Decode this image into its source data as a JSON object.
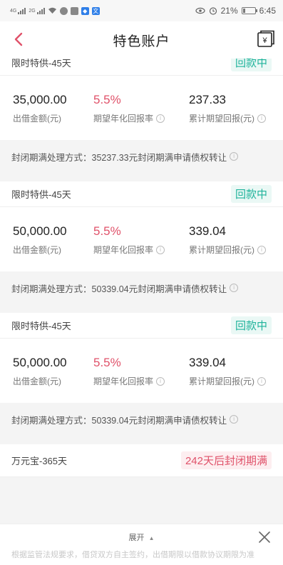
{
  "statusbar": {
    "net1": "4G",
    "net2": "2G",
    "battery": "21%",
    "battery_level": 0.21,
    "time": "6:45",
    "icons": [
      "wifi-icon",
      "chat-icon",
      "message-icon",
      "shield-icon",
      "app-icon",
      "eye-icon",
      "alarm-icon",
      "battery-icon"
    ]
  },
  "header": {
    "title": "特色账户",
    "back_icon": "chevron-left-icon",
    "wallet_icon": "wallet-yen-icon",
    "wallet_glyph": "¥"
  },
  "cards": [
    {
      "name": "限时特供-45天",
      "status": "回款中",
      "amount": "35,000.00",
      "amount_label": "出借金额(元)",
      "rate": "5.5%",
      "rate_label": "期望年化回报率",
      "return": "237.33",
      "return_label": "累计期望回报(元)",
      "footer": "封闭期满处理方式：35237.33元封闭期满申请债权转让"
    },
    {
      "name": "限时特供-45天",
      "status": "回款中",
      "amount": "50,000.00",
      "amount_label": "出借金额(元)",
      "rate": "5.5%",
      "rate_label": "期望年化回报率",
      "return": "339.04",
      "return_label": "累计期望回报(元)",
      "footer": "封闭期满处理方式：50339.04元封闭期满申请债权转让"
    },
    {
      "name": "限时特供-45天",
      "status": "回款中",
      "amount": "50,000.00",
      "amount_label": "出借金额(元)",
      "rate": "5.5%",
      "rate_label": "期望年化回报率",
      "return": "339.04",
      "return_label": "累计期望回报(元)",
      "footer": "封闭期满处理方式：50339.04元封闭期满申请债权转让"
    },
    {
      "name": "万元宝-365天",
      "status": "242天后封闭期满"
    }
  ],
  "bottom": {
    "expand_label": "展开",
    "disclaimer": "根据监管法规要求，借贷双方自主签约，出借期限以借款协议期限为准"
  },
  "colors": {
    "accent": "#e0526a",
    "status_green": "#1fb39b"
  }
}
